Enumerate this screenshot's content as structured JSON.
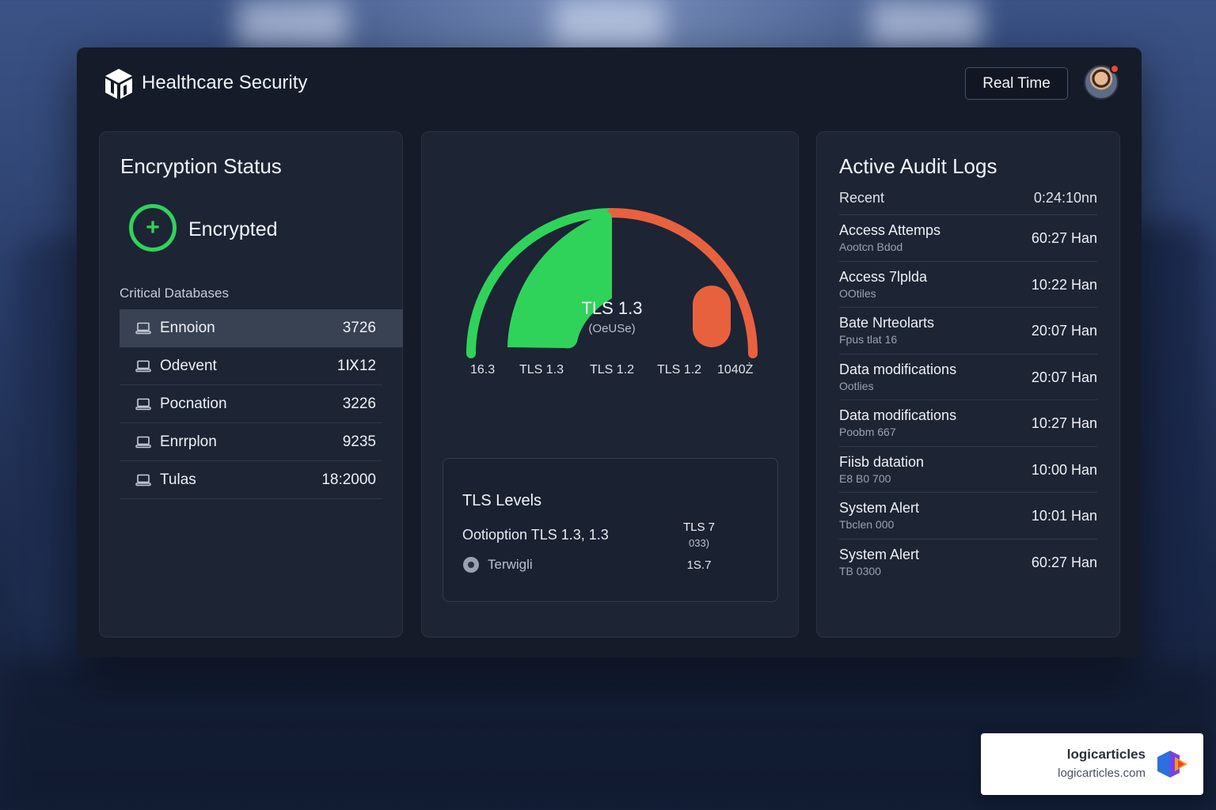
{
  "header": {
    "app_title": "Healthcare Security",
    "realtime_label": "Real Time",
    "logo_icon": "cube-logo-icon",
    "avatar_icon": "user-avatar",
    "notification_color": "#e6463f"
  },
  "encryption": {
    "title": "Encryption Status",
    "status_label": "Encrypted",
    "status_icon": "plus-circle-icon",
    "status_color": "#2fd35a",
    "databases_heading": "Critical Databases",
    "databases": [
      {
        "name": "Ennoion",
        "count": "3726",
        "selected": true
      },
      {
        "name": "Odevent",
        "count": "1Ⅸ12",
        "selected": false
      },
      {
        "name": "Pocnation",
        "count": "3226",
        "selected": false
      },
      {
        "name": "Enrrplon",
        "count": "9235",
        "selected": false
      },
      {
        "name": "Tulas",
        "count": "18:2000",
        "selected": false
      }
    ]
  },
  "gauge": {
    "center_label": "TLS 1.3",
    "center_sub": "(OeUSe)",
    "ticks": [
      "16.3",
      "TLS 1.3",
      "TLS 1.2",
      "TLS 1.2",
      "1040Ż"
    ],
    "colors": {
      "secure": "#2fd35a",
      "insecure": "#e8613f"
    },
    "tls_box": {
      "title": "TLS Levels",
      "option": "Ootioption TLS 1.3, 1.3",
      "radio_label": "Terwigli",
      "mini_main": "TLS 7",
      "mini_sub": "033)",
      "mini_value": "1S.7"
    }
  },
  "audit": {
    "title": "Active Audit Logs",
    "recent_label": "Recent",
    "recent_time": "0:24:10nn",
    "entries": [
      {
        "name": "Access Attemps",
        "sub": "Aootcn Bdod",
        "time": "60:27 Han"
      },
      {
        "name": "Access 7lplda",
        "sub": "OOtiles",
        "time": "10:22 Han"
      },
      {
        "name": "Bate Nrteolarts",
        "sub": "Fpus tlat 16",
        "time": "20:07 Han"
      },
      {
        "name": "Data modifications",
        "sub": "Ootlies",
        "time": "20:07 Han"
      },
      {
        "name": "Data modifications",
        "sub": "Poobm 667",
        "time": "10:27 Han"
      },
      {
        "name": "Fiisb datation",
        "sub": "E8 B0 700",
        "time": "10:00 Han"
      },
      {
        "name": "System Alert",
        "sub": "Tbclen 000",
        "time": "10:01 Han"
      },
      {
        "name": "System Alert",
        "sub": "TB 0300",
        "time": "60:27 Han"
      }
    ]
  },
  "watermark": {
    "name": "logicarticles",
    "url": "logicarticles.com"
  }
}
